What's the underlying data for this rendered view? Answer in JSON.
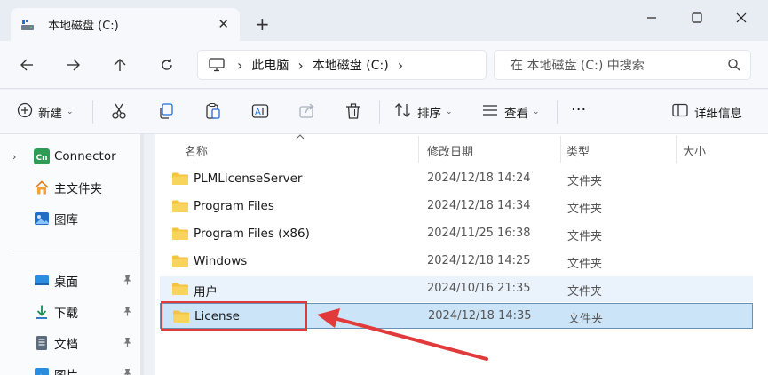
{
  "window": {
    "tab_title": "本地磁盘 (C:)",
    "tab_close": "✕",
    "new_tab": "+"
  },
  "address": {
    "breadcrumbs": [
      "此电脑",
      "本地磁盘 (C:)"
    ],
    "separator": "›",
    "search_placeholder": "在 本地磁盘 (C:) 中搜索"
  },
  "toolbar": {
    "new_label": "新建",
    "sort_label": "排序",
    "view_label": "查看",
    "more_label": "···",
    "details_label": "详细信息"
  },
  "sidebar": {
    "items": [
      {
        "label": "Connector",
        "icon": "connector-app-icon",
        "badge": "Cn",
        "expandable": true
      },
      {
        "label": "主文件夹",
        "icon": "home-icon"
      },
      {
        "label": "图库",
        "icon": "gallery-icon"
      },
      {
        "label": "桌面",
        "icon": "desktop-folder-icon",
        "pinned": true
      },
      {
        "label": "下载",
        "icon": "download-icon",
        "pinned": true
      },
      {
        "label": "文档",
        "icon": "documents-icon",
        "pinned": true
      },
      {
        "label": "图片",
        "icon": "pictures-icon",
        "pinned": true
      }
    ],
    "pin_glyph": "📌"
  },
  "columns": {
    "name": "名称",
    "date": "修改日期",
    "type": "类型",
    "size": "大小"
  },
  "files": [
    {
      "name": "PLMLicenseServer",
      "date": "2024/12/18 14:24",
      "type": "文件夹"
    },
    {
      "name": "Program Files",
      "date": "2024/12/18 14:34",
      "type": "文件夹"
    },
    {
      "name": "Program Files (x86)",
      "date": "2024/11/25 16:38",
      "type": "文件夹"
    },
    {
      "name": "Windows",
      "date": "2024/12/18 14:25",
      "type": "文件夹"
    },
    {
      "name": "用户",
      "date": "2024/10/16 21:35",
      "type": "文件夹",
      "state": "hover"
    },
    {
      "name": "License",
      "date": "2024/12/18 14:35",
      "type": "文件夹",
      "state": "selected"
    }
  ],
  "colors": {
    "folder": "#f5c342",
    "selection": "#cce4f7",
    "annotation": "#e03a3a",
    "accent": "#0067c0"
  }
}
